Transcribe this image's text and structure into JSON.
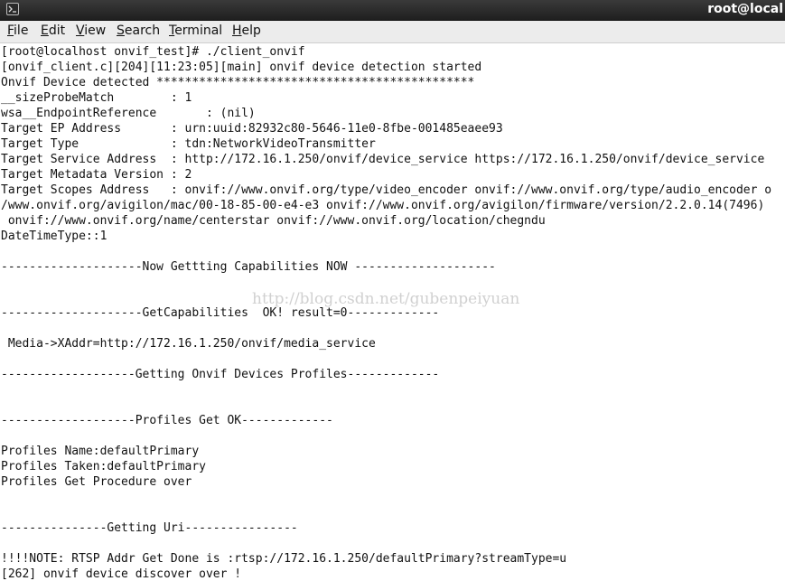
{
  "window": {
    "title": "root@local",
    "icon": "terminal-icon"
  },
  "menu": [
    {
      "mnemonic": "F",
      "rest": "ile"
    },
    {
      "mnemonic": "E",
      "rest": "dit"
    },
    {
      "mnemonic": "V",
      "rest": "iew"
    },
    {
      "mnemonic": "S",
      "rest": "earch"
    },
    {
      "mnemonic": "T",
      "rest": "erminal"
    },
    {
      "mnemonic": "H",
      "rest": "elp"
    }
  ],
  "terminal": {
    "lines": [
      "[root@localhost onvif_test]# ./client_onvif",
      "[onvif_client.c][204][11:23:05][main] onvif device detection started",
      "Onvif Device detected *********************************************",
      "__sizeProbeMatch        : 1",
      "wsa__EndpointReference       : (nil)",
      "Target EP Address       : urn:uuid:82932c80-5646-11e0-8fbe-001485eaee93",
      "Target Type             : tdn:NetworkVideoTransmitter",
      "Target Service Address  : http://172.16.1.250/onvif/device_service https://172.16.1.250/onvif/device_service",
      "Target Metadata Version : 2",
      "Target Scopes Address   : onvif://www.onvif.org/type/video_encoder onvif://www.onvif.org/type/audio_encoder o",
      "/www.onvif.org/avigilon/mac/00-18-85-00-e4-e3 onvif://www.onvif.org/avigilon/firmware/version/2.2.0.14(7496)",
      " onvif://www.onvif.org/name/centerstar onvif://www.onvif.org/location/chegndu",
      "DateTimeType::1",
      "",
      "--------------------Now Gettting Capabilities NOW --------------------",
      "",
      "",
      "--------------------GetCapabilities  OK! result=0-------------",
      "",
      " Media->XAddr=http://172.16.1.250/onvif/media_service",
      "",
      "-------------------Getting Onvif Devices Profiles-------------",
      "",
      "",
      "-------------------Profiles Get OK-------------",
      "",
      "Profiles Name:defaultPrimary",
      "Profiles Taken:defaultPrimary",
      "Profiles Get Procedure over",
      "",
      "",
      "---------------Getting Uri----------------",
      "",
      "!!!!NOTE: RTSP Addr Get Done is :rtsp://172.16.1.250/defaultPrimary?streamType=u",
      "[262] onvif device discover over !"
    ]
  },
  "watermark": "http://blog.csdn.net/gubenpeiyuan"
}
